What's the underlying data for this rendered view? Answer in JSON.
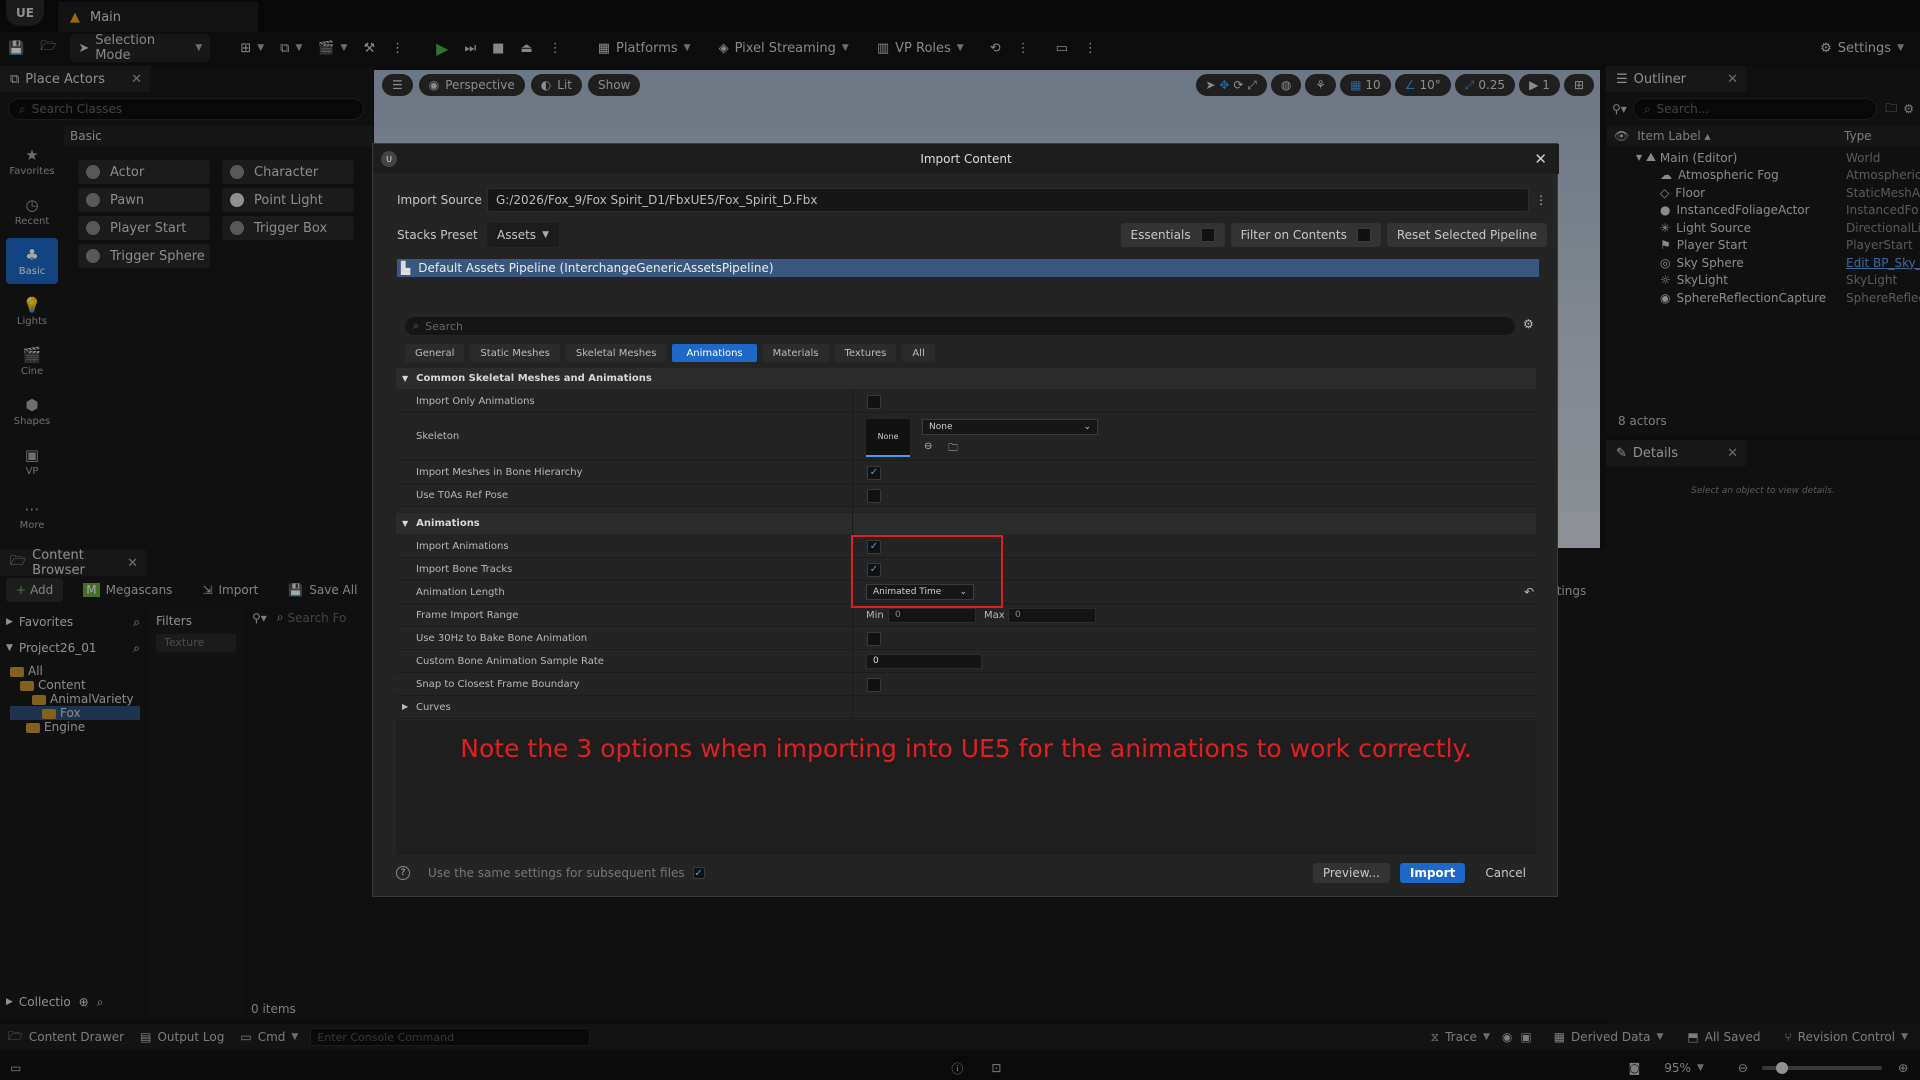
{
  "window": {
    "tab_label": "Main",
    "logo": "UE"
  },
  "toolbar": {
    "selection_mode": "Selection Mode",
    "platforms": "Platforms",
    "pixel_streaming": "Pixel Streaming",
    "vp_roles": "VP Roles",
    "settings": "Settings"
  },
  "place_actors": {
    "tab": "Place Actors",
    "search_placeholder": "Search Classes",
    "section": "Basic",
    "categories": [
      "Favorites",
      "Recent",
      "Basic",
      "Lights",
      "Cine",
      "Shapes",
      "VP",
      "More"
    ],
    "actors": [
      "Actor",
      "Character",
      "Pawn",
      "Point Light",
      "Player Start",
      "Trigger Box",
      "Trigger Sphere"
    ]
  },
  "viewport": {
    "perspective": "Perspective",
    "lit": "Lit",
    "show": "Show",
    "grid": "10",
    "angle": "10°",
    "scale": "0.25",
    "camera": "1"
  },
  "outliner": {
    "tab": "Outliner",
    "search_placeholder": "Search...",
    "col_label": "Item Label ▴",
    "col_type": "Type",
    "items": [
      {
        "label": "Main (Editor)",
        "type": "World"
      },
      {
        "label": "Atmospheric Fog",
        "type": "Atmospheric"
      },
      {
        "label": "Floor",
        "type": "StaticMeshA"
      },
      {
        "label": "InstancedFoliageActor",
        "type": "InstancedFo"
      },
      {
        "label": "Light Source",
        "type": "DirectionalLi"
      },
      {
        "label": "Player Start",
        "type": "PlayerStart"
      },
      {
        "label": "Sky Sphere",
        "type": "Edit BP_Sky_"
      },
      {
        "label": "SkyLight",
        "type": "SkyLight"
      },
      {
        "label": "SphereReflectionCapture",
        "type": "SphereReflec"
      }
    ],
    "count": "8 actors"
  },
  "details": {
    "tab": "Details",
    "empty": "Select an object to view details."
  },
  "content_browser": {
    "tab": "Content Browser",
    "add": "Add",
    "megascans": "Megascans",
    "import": "Import",
    "save_all": "Save All",
    "settings_partial": "ttings",
    "favorites": "Favorites",
    "project": "Project26_01",
    "filters": "Filters",
    "filter_chip": "Texture",
    "search_placeholder": "Search Fo",
    "tree": [
      "All",
      "Content",
      "AnimalVariety",
      "Fox",
      "Engine"
    ],
    "collections": "Collectio",
    "items_count": "0 items"
  },
  "statusbar": {
    "content_drawer": "Content Drawer",
    "output_log": "Output Log",
    "cmd": "Cmd",
    "console_placeholder": "Enter Console Command",
    "trace": "Trace",
    "derived_data": "Derived Data",
    "all_saved": "All Saved",
    "revision_control": "Revision Control",
    "zoom": "95%"
  },
  "dialog": {
    "title": "Import Content",
    "import_source_label": "Import Source",
    "import_source_path": "G:/2026/Fox_9/Fox Spirit_D1/FbxUE5/Fox_Spirit_D.Fbx",
    "stacks_preset_label": "Stacks Preset",
    "stacks_preset_value": "Assets",
    "essentials": "Essentials",
    "filter_on_contents": "Filter on Contents",
    "reset_pipeline": "Reset Selected Pipeline",
    "pipeline_name": "Default Assets Pipeline (InterchangeGenericAssetsPipeline)",
    "search_placeholder": "Search",
    "tabs": [
      "General",
      "Static Meshes",
      "Skeletal Meshes",
      "Animations",
      "Materials",
      "Textures",
      "All"
    ],
    "section1": "Common Skeletal Meshes and Animations",
    "rows1": [
      "Import Only Animations",
      "Skeleton",
      "Import Meshes in Bone Hierarchy",
      "Use T0As Ref Pose"
    ],
    "skeleton_thumb": "None",
    "skeleton_value": "None",
    "section2": "Animations",
    "rows2": [
      "Import Animations",
      "Import Bone Tracks",
      "Animation Length",
      "Frame Import Range",
      "Use 30Hz to Bake Bone Animation",
      "Custom Bone Animation Sample Rate",
      "Snap to Closest Frame Boundary",
      "Curves"
    ],
    "animation_length_value": "Animated Time",
    "min_label": "Min",
    "min_value": "0",
    "max_label": "Max",
    "max_value": "0",
    "sample_rate_value": "0",
    "note": "Note the 3 options when importing into UE5 for the animations to work correctly.",
    "note_color": "#e02020",
    "use_same_settings": "Use the same settings for subsequent files",
    "preview": "Preview...",
    "import": "Import",
    "cancel": "Cancel"
  }
}
